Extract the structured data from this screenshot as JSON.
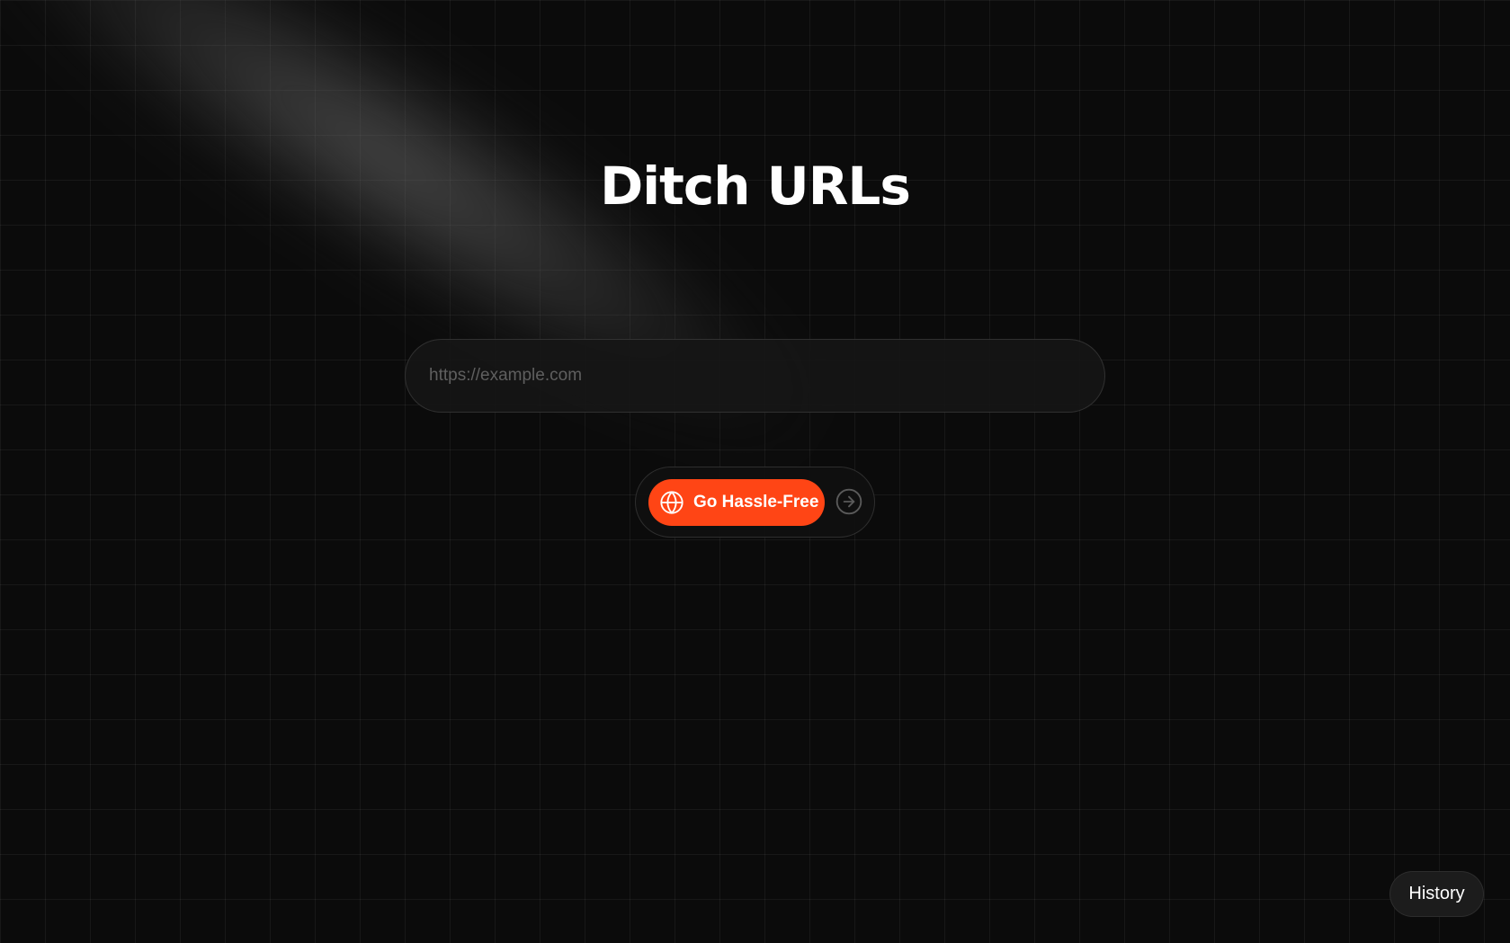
{
  "hero": {
    "title": "Ditch URLs"
  },
  "url_input": {
    "placeholder": "https://example.com",
    "value": ""
  },
  "actions": {
    "go_label": "Go Hassle-Free",
    "go_icon": "globe-icon",
    "submit_icon": "arrow-right-circle-icon"
  },
  "history": {
    "label": "History"
  },
  "colors": {
    "background": "#0b0b0b",
    "accent": "#ff4515",
    "text": "#ffffff"
  }
}
